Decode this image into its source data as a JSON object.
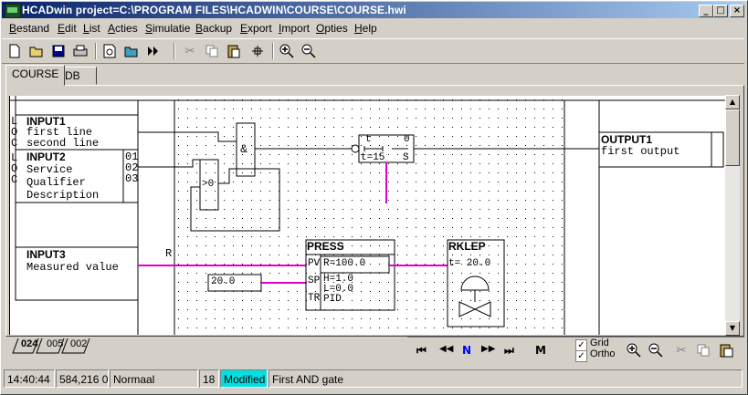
{
  "window": {
    "title": "HCADwin project=C:\\PROGRAM FILES\\HCADWIN\\COURSE\\COURSE.hwi",
    "minimize": "_",
    "maximize": "□",
    "close": "×"
  },
  "menu": [
    "Bestand",
    "Edit",
    "List",
    "Acties",
    "Simulatie",
    "Backup",
    "Export",
    "Import",
    "Opties",
    "Help"
  ],
  "toolbar_icons": [
    "new-file-icon",
    "open-folder-icon",
    "save-icon",
    "print-icon",
    "print-preview-icon",
    "open-icon",
    "run-icon",
    "cut-icon",
    "copy-icon",
    "paste-icon",
    "align-icon",
    "zoom-in-icon",
    "zoom-out-icon"
  ],
  "tabs": [
    "COURSE",
    "DB"
  ],
  "diagram": {
    "inputs": [
      {
        "name": "INPUT1",
        "flags": [
          "L",
          "O",
          "C"
        ],
        "lines": [
          "first line",
          "second line"
        ],
        "pins": []
      },
      {
        "name": "INPUT2",
        "flags": [
          "L",
          "O",
          "C"
        ],
        "lines": [
          "Service",
          "Qualifier",
          "Description"
        ],
        "pins": [
          "01",
          "02",
          "03"
        ]
      },
      {
        "name": "INPUT3",
        "flags": [],
        "lines": [
          "Measured value"
        ],
        "pins": []
      }
    ],
    "r_label": "R",
    "and_gate": "&",
    "gt_gate": ">0",
    "timer": {
      "t": "t",
      "zero": "0",
      "t15": "t=15",
      "s": "S"
    },
    "output": {
      "name": "OUTPUT1",
      "line": "first output"
    },
    "press": {
      "name": "PRESS",
      "pv": "PV",
      "sp": "SP",
      "tr": "TR",
      "r": "R=100.0",
      "h": "H=1.0",
      "l": "L=0.0",
      "pid": "PID"
    },
    "setpoint": "20.0",
    "rklep": {
      "name": "RKLEP",
      "t": "t= 20.0"
    }
  },
  "page_tabs": [
    "024",
    "005",
    "002"
  ],
  "nav": {
    "first": "⏮",
    "prev": "◀◀",
    "n": "N",
    "next": "▶▶",
    "last": "⏭",
    "m": "M",
    "grid": "Grid",
    "ortho": "Ortho"
  },
  "status": {
    "time": "14:40:44",
    "coords": "584,216 0",
    "mode": "Normaal",
    "count": "18",
    "modified": "Modified",
    "message": "First AND gate"
  },
  "colors": {
    "link": "#e000c8",
    "modified_bg": "#00e0e0",
    "title_start": "#0a246a"
  }
}
